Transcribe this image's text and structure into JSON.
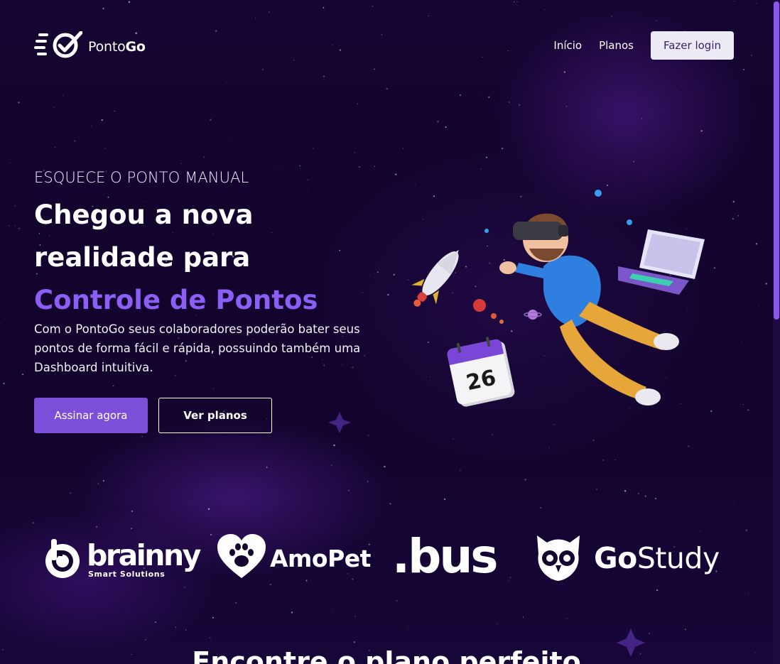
{
  "header": {
    "brand_name": "Ponto",
    "brand_bold": "Go",
    "nav": [
      "Início",
      "Planos"
    ],
    "login_label": "Fazer login"
  },
  "hero": {
    "eyebrow": "ESQUECE O PONTO MANUAL",
    "headline_line1": "Chegou a nova",
    "headline_line2": "realidade para",
    "headline_accent": "Controle de Pontos",
    "description": "Com o PontoGo seus colaboradores poderão bater seus pontos de forma fácil e rápida, possuindo também uma Dashboard intuitiva.",
    "primary_cta": "Assinar agora",
    "secondary_cta": "Ver planos",
    "calendar_day": "26"
  },
  "partners": {
    "brainny": {
      "name": "brainny",
      "tagline": "Smart Solutions"
    },
    "amopet": {
      "name": "AmoPet"
    },
    "bus": {
      "name": ".bus"
    },
    "gostudy": {
      "name_bold": "Go",
      "name_rest": "Study"
    }
  },
  "section": {
    "title": "Encontre o plano perfeito"
  },
  "colors": {
    "background": "#12042e",
    "accent": "#8b5ef5",
    "primary_button": "#7c4fd8",
    "login_button_bg": "#eceaf4",
    "login_button_text": "#3a1f6f"
  },
  "icons": [
    "pontogo-logo-icon",
    "brainny-logo-icon",
    "paw-heart-icon",
    "owl-icon"
  ]
}
